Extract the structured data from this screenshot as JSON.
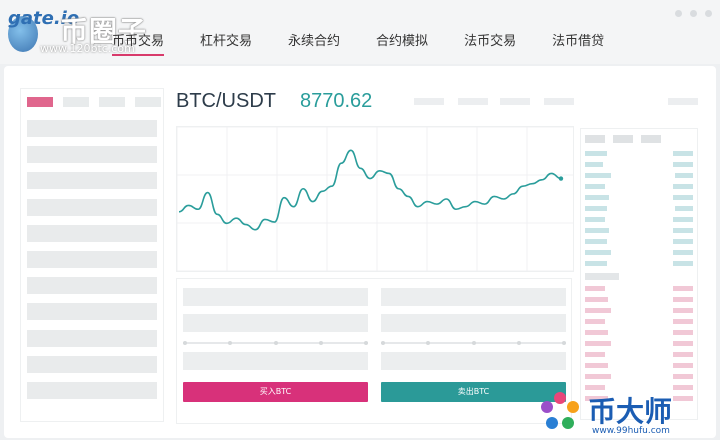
{
  "logo": {
    "brand": "gate.io",
    "site_cn": "币圈子",
    "site_url": "www.120btc.com"
  },
  "nav": {
    "items": [
      "币币交易",
      "杠杆交易",
      "永续合约",
      "合约模拟",
      "法币交易",
      "法币借贷"
    ],
    "active_index": 0
  },
  "ticker": {
    "pair": "BTC/USDT",
    "price": "8770.62"
  },
  "chart_data": {
    "type": "line",
    "x": [
      0,
      1,
      2,
      3,
      4,
      5,
      6,
      7,
      8,
      9,
      10,
      11,
      12,
      13,
      14,
      15,
      16,
      17,
      18,
      19,
      20,
      21,
      22,
      23,
      24,
      25,
      26,
      27,
      28,
      29,
      30,
      31,
      32,
      33,
      34,
      35,
      36,
      37,
      38,
      39,
      40
    ],
    "series": [
      {
        "values": [
          40,
          45,
          42,
          55,
          38,
          31,
          35,
          30,
          26,
          34,
          32,
          51,
          44,
          58,
          48,
          56,
          60,
          78,
          88,
          74,
          66,
          72,
          70,
          58,
          52,
          44,
          48,
          46,
          50,
          42,
          44,
          48,
          46,
          52,
          50,
          54,
          60,
          62,
          65,
          70,
          66
        ]
      }
    ],
    "ylim": [
      0,
      100
    ],
    "grid": true,
    "color": "#2a9d9b"
  },
  "actions": {
    "buy_label": "买入BTC",
    "sell_label": "卖出BTC"
  },
  "colors": {
    "accent": "#d8317a",
    "teal": "#2a9d9b",
    "ask": "#f1c8d6",
    "bid": "#c8e3e6"
  },
  "watermark": {
    "site_cn": "币大师",
    "site_url": "www.99hufu.com"
  }
}
